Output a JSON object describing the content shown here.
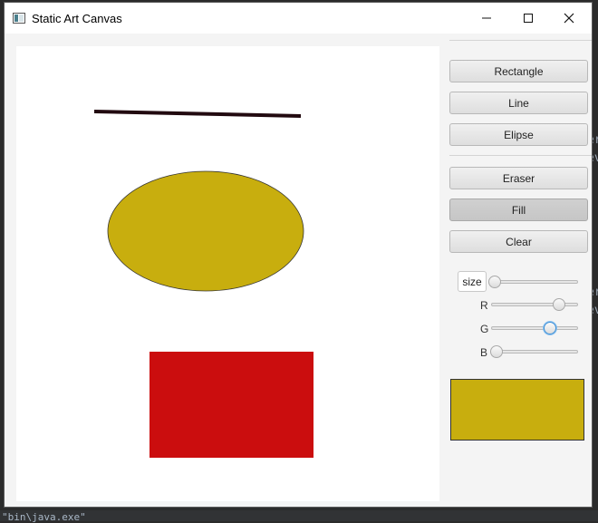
{
  "window": {
    "title": "Static Art Canvas",
    "icon": "app-window-icon",
    "controls": [
      "minimize-icon",
      "maximize-icon",
      "close-icon"
    ]
  },
  "canvas": {
    "background": "#ffffff",
    "shapes": [
      {
        "type": "line",
        "color": "#220a10",
        "stroke": "thick"
      },
      {
        "type": "ellipse",
        "fill": "#c8ae0e",
        "outline": "#333333"
      },
      {
        "type": "rectangle",
        "fill": "#cb0d0e"
      }
    ]
  },
  "toolbar": {
    "rectangle_label": "Rectangle",
    "line_label": "Line",
    "ellipse_label": "Elipse",
    "eraser_label": "Eraser",
    "fill_label": "Fill",
    "clear_label": "Clear",
    "active_tool": "Fill"
  },
  "controls": {
    "size_label": "size",
    "size_value": 0.04,
    "r_label": "R",
    "r_value": 0.78,
    "g_label": "G",
    "g_value": 0.68,
    "b_label": "B",
    "b_value": 0.06,
    "focused_slider": "G"
  },
  "preview": {
    "color": "#c8ae0e"
  },
  "background_app": {
    "fragment_1": "er",
    "fragment_2": "ev",
    "fragment_3": "er",
    "fragment_4": "ev",
    "bottom_text": "\"bin\\java.exe\""
  }
}
